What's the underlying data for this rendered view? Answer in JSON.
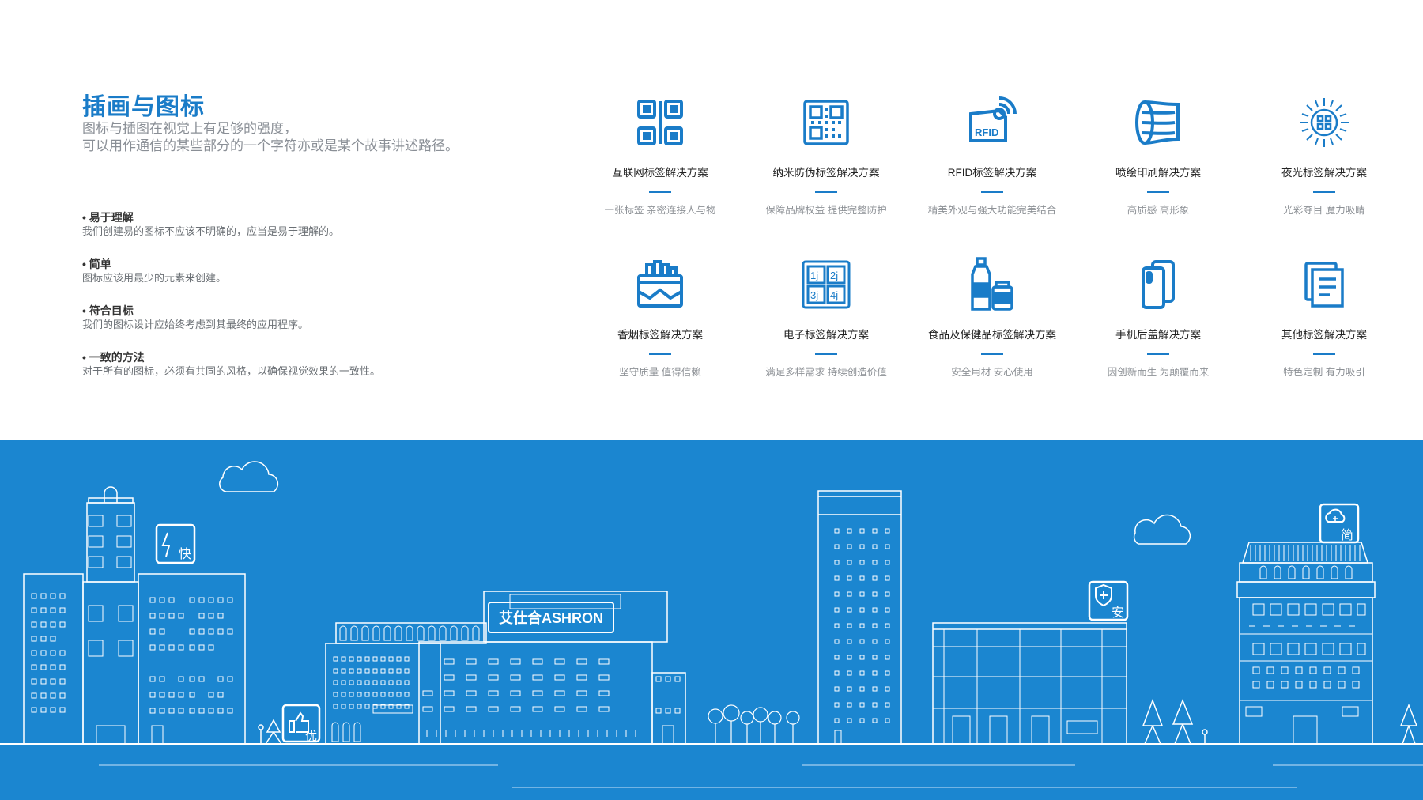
{
  "title": "插画与图标",
  "intro": [
    "图标与插图在视觉上有足够的强度，",
    "可以用作通信的某些部分的一个字符亦或是某个故事讲述路径。"
  ],
  "principles": [
    {
      "title": "易于理解",
      "desc": "我们创建易的图标不应该不明确的，应当是易于理解的。"
    },
    {
      "title": "简单",
      "desc": "图标应该用最少的元素来创建。"
    },
    {
      "title": "符合目标",
      "desc": "我们的图标设计应始终考虑到其最终的应用程序。"
    },
    {
      "title": "一致的方法",
      "desc": "对于所有的图标，必须有共同的风格，以确保视觉效果的一致性。"
    }
  ],
  "solutions": [
    {
      "name": "互联网标签解决方案",
      "sub": "一张标签  亲密连接人与物",
      "icon": "qr-code-icon"
    },
    {
      "name": "纳米防伪标签解决方案",
      "sub": "保障品牌权益  提供完整防护",
      "icon": "nano-anti-counterfeit-icon"
    },
    {
      "name": "RFID标签解决方案",
      "sub": "精美外观与强大功能完美结合",
      "icon": "rfid-icon",
      "icon_text": "RFID"
    },
    {
      "name": "喷绘印刷解决方案",
      "sub": "高质感  高形象",
      "icon": "print-roll-icon"
    },
    {
      "name": "夜光标签解决方案",
      "sub": "光彩夺目  魔力吸睛",
      "icon": "glow-icon"
    },
    {
      "name": "香烟标签解决方案",
      "sub": "坚守质量  值得信赖",
      "icon": "cigarette-pack-icon"
    },
    {
      "name": "电子标签解决方案",
      "sub": "满足多样需求  持续创造价值",
      "icon": "electronic-label-icon",
      "icon_text": [
        "1j",
        "2j",
        "3j",
        "4j"
      ]
    },
    {
      "name": "食品及保健品标签解决方案",
      "sub": "安全用材  安心使用",
      "icon": "bottles-icon"
    },
    {
      "name": "手机后盖解决方案",
      "sub": "因创新而生  为颠覆而来",
      "icon": "phone-cover-icon"
    },
    {
      "name": "其他标签解决方案",
      "sub": "特色定制  有力吸引",
      "icon": "documents-icon"
    }
  ],
  "banner": {
    "brand": "艾仕合ASHRON",
    "badges": [
      "快",
      "优",
      "安",
      "简"
    ],
    "colors": {
      "background": "#1b86d0",
      "line": "#ffffff"
    }
  },
  "colors": {
    "accent": "#1a7cc8",
    "text": "#222222",
    "muted": "#8a8f96"
  }
}
